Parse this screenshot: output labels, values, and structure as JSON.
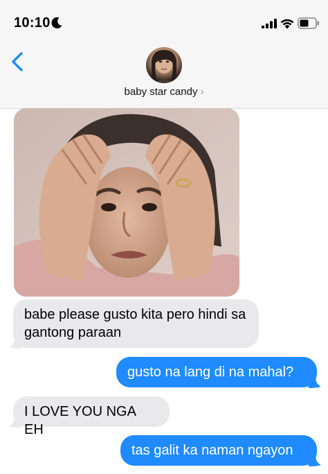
{
  "status": {
    "time": "10:10",
    "icons": [
      "moon-icon",
      "cellular-signal-icon",
      "wifi-icon",
      "battery-icon"
    ]
  },
  "header": {
    "back_icon": "chevron-left-icon",
    "contact_name": "baby star candy",
    "contact_chevron": "›"
  },
  "messages": [
    {
      "type": "image",
      "direction": "incoming",
      "description_icon": "photo-attachment"
    },
    {
      "type": "text",
      "direction": "incoming",
      "text": "babe please gusto kita pero hindi sa gantong paraan"
    },
    {
      "type": "text",
      "direction": "outgoing",
      "text": "gusto na lang di na mahal?"
    },
    {
      "type": "text",
      "direction": "incoming",
      "text": "I LOVE YOU NGA EH"
    },
    {
      "type": "text",
      "direction": "outgoing",
      "text": "tas galit ka naman ngayon"
    }
  ],
  "colors": {
    "accent": "#1f8bff",
    "incoming_bubble": "#e9e9eb",
    "header_bg": "#f6f6f6"
  }
}
